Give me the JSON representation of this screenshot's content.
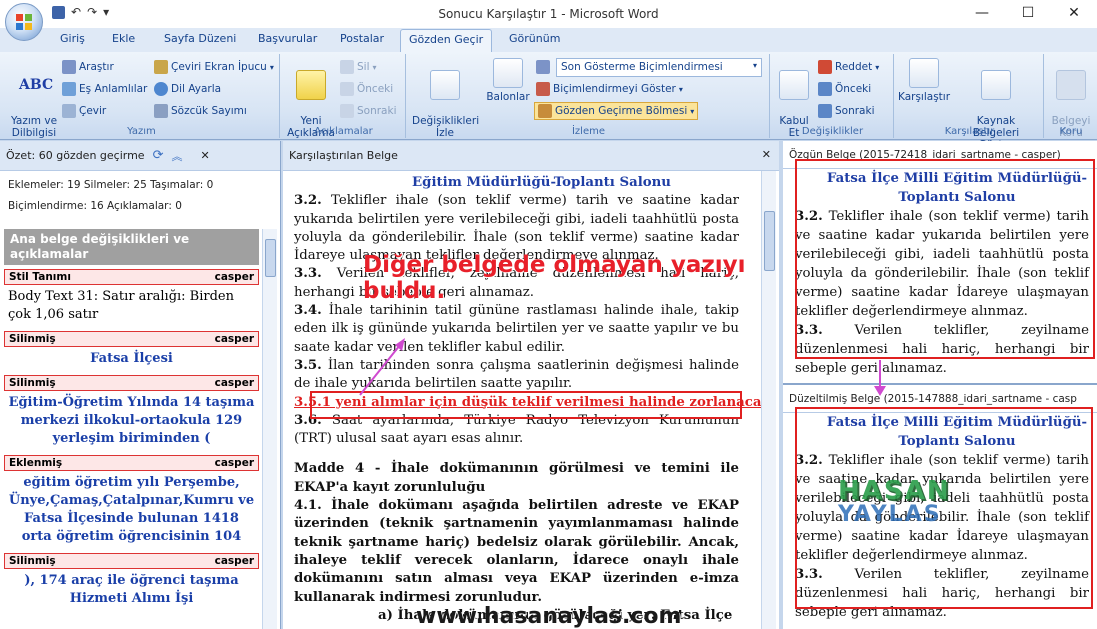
{
  "window": {
    "title": "Sonucu Karşılaştır 1 - Microsoft Word",
    "controls": {
      "minimize": "—",
      "maximize": "☐",
      "close": "✕"
    }
  },
  "qat": {
    "save_icon": "save-icon",
    "undo": "↶",
    "redo": "↷",
    "more": "▾"
  },
  "tabs": [
    "Giriş",
    "Ekle",
    "Sayfa Düzeni",
    "Başvurular",
    "Postalar",
    "Gözden Geçir",
    "Görünüm"
  ],
  "active_tab": "Gözden Geçir",
  "ribbon": {
    "yazim": {
      "label": "Yazım",
      "spelling": "Yazım ve\nDilbilgisi",
      "abc": "ABC",
      "research": "Araştır",
      "thesaurus": "Eş Anlamlılar",
      "translate": "Çevir",
      "translate_tip": "Çeviri Ekran İpucu",
      "language": "Dil Ayarla",
      "wordcount": "Sözcük Sayımı"
    },
    "aciklamalar": {
      "label": "Açıklamalar",
      "new": "Yeni\nAçıklama",
      "delete": "Sil",
      "prev": "Önceki",
      "next": "Sonraki"
    },
    "izleme": {
      "label": "İzleme",
      "track": "Değişiklikleri\nİzle",
      "balloons": "Balonlar",
      "display_combo": "Son Gösterme Biçimlendirmesi",
      "show_markup": "Biçimlendirmeyi Göster",
      "review_pane": "Gözden Geçirme Bölmesi"
    },
    "degisiklikler": {
      "label": "Değişiklikler",
      "accept": "Kabul\nEt",
      "reject": "Reddet",
      "prev": "Önceki",
      "next": "Sonraki"
    },
    "karsilastir": {
      "label": "Karşılaştır",
      "compare": "Karşılaştır",
      "show_source": "Kaynak Belgeleri\nGöster"
    },
    "koru": {
      "label": "Koru",
      "protect": "Belgeyi\nKoru"
    }
  },
  "review_pane": {
    "summary": "Özet: 60 gözden geçirme",
    "stats_line1": "Eklemeler: 19  Silmeler: 25  Taşımalar: 0",
    "stats_line2": "Biçimlendirme: 16  Açıklamalar: 0",
    "section_title": "Ana belge değişiklikleri ve açıklamalar",
    "items": [
      {
        "type": "Stil Tanımı",
        "author": "casper",
        "text": "Body Text 31: Satır aralığı:  Birden çok 1,06 satır",
        "plain": true
      },
      {
        "type": "Silinmiş",
        "author": "casper",
        "text": "Fatsa İlçesi",
        "plain": false
      },
      {
        "type": "Silinmiş",
        "author": "casper",
        "text": "Eğitim-Öğretim Yılında 14 taşıma merkezi ilkokul-ortaokula 129 yerleşim biriminden (",
        "plain": false
      },
      {
        "type": "Eklenmiş",
        "author": "casper",
        "text": "eğitim öğretim yılı Perşembe, Ünye,Çamaş,Çatalpınar,Kumru ve Fatsa İlçesinde bulunan 1418 orta öğretim öğrencisinin 104",
        "plain": false
      },
      {
        "type": "Silinmiş",
        "author": "casper",
        "text": "), 174 araç ile öğrenci taşıma Hizmeti Alımı İşi",
        "plain": false
      }
    ]
  },
  "compared_doc": {
    "header": "Karşılaştırılan Belge",
    "close": "✕",
    "top_heading": "Eğitim Müdürlüğü-Toplantı Salonu",
    "p32": {
      "num": "3.2.",
      "text": "Teklifler ihale (son teklif verme) tarih ve saatine kadar yukarıda belirtilen yere verilebileceği gibi, iadeli taahhütlü posta yoluyla da gönderilebilir. İhale (son teklif verme) saatine kadar İdareye ulaşmayan teklifler değerlendirmeye alınmaz."
    },
    "p33": {
      "num": "3.3.",
      "text": "Verilen teklifler, zeyilname düzenlenmesi hali hariç, herhangi bir sebeple geri alınamaz."
    },
    "p34": {
      "num": "3.4.",
      "text": "İhale tarihinin tatil gününe rastlaması halinde ihale, takip eden ilk iş gününde yukarıda belirtilen yer ve saatte yapılır ve bu saate kadar verilen teklifler kabul edilir."
    },
    "p35": {
      "num": "3.5.",
      "text": "İlan tarihinden sonra çalışma saatlerinin değişmesi halinde de ihale yukarıda belirtilen saatte yapılır."
    },
    "p351": "3.5.1 yeni alımlar için düşük teklif verilmesi halinde zorlanacaktır.",
    "p36": {
      "num": "3.6.",
      "text": "Saat ayarlarında, Türkiye Radyo Televizyon Kurumunun (TRT) ulusal saat ayarı esas alınır."
    },
    "madde4": "Madde 4 - İhale dokümanının görülmesi ve temini ile EKAP'a kayıt zorunluluğu",
    "p41": "4.1. İhale dokümanı aşağıda belirtilen adreste ve EKAP üzerinden (teknik şartnamenin yayımlanmaması halinde teknik şartname hariç) bedelsiz olarak görülebilir. Ancak, ihaleye teklif verecek olanların, İdarece onaylı ihale dokümanını satın alması veya EKAP üzerinden e-imza kullanarak indirmesi zorunludur.",
    "p41a": "a) İhale dokümanının görüleceği yer: Fatsa İlçe"
  },
  "original_doc": {
    "header": "Özgün Belge (2015-72418_idari_sartname - casper)",
    "heading": "Fatsa İlçe Milli Eğitim Müdürlüğü-Toplantı Salonu",
    "p32": {
      "num": "3.2.",
      "text": "Teklifler ihale (son teklif verme) tarih ve saatine kadar yukarıda belirtilen yere verilebileceği gibi, iadeli taahhütlü posta yoluyla da gönderilebilir. İhale (son teklif verme) saatine kadar İdareye ulaşmayan teklifler değerlendirmeye alınmaz."
    },
    "p33": {
      "num": "3.3.",
      "text": "Verilen teklifler, zeyilname düzenlenmesi hali hariç, herhangi bir sebeple geri alınamaz."
    }
  },
  "revised_doc": {
    "header": "Düzeltilmiş Belge (2015-147888_idari_sartname - casp",
    "heading": "Fatsa İlçe Milli Eğitim Müdürlüğü-Toplantı Salonu",
    "p32": {
      "num": "3.2.",
      "text": "Teklifler ihale (son teklif verme) tarih ve saatine kadar yukarıda belirtilen yere verilebileceği gibi, iadeli taahhütlü posta yoluyla da gönderilebilir. İhale (son teklif verme) saatine kadar İdareye ulaşmayan teklifler değerlendirmeye alınmaz."
    },
    "p33": {
      "num": "3.3.",
      "text": "Verilen teklifler, zeyilname düzenlenmesi hali hariç, herhangi bir sebeple geri alınamaz."
    }
  },
  "annotation": "Diğer belgede olmayan yazıyı buldu.",
  "watermark": {
    "logo_top": "HASAN",
    "logo_bottom": "YAYLAS",
    "url": "www.hasanaylas.com"
  },
  "colors": {
    "accent_red": "#e02020",
    "heading_blue": "#1f3ea5",
    "ribbon_blue": "#15428b"
  }
}
